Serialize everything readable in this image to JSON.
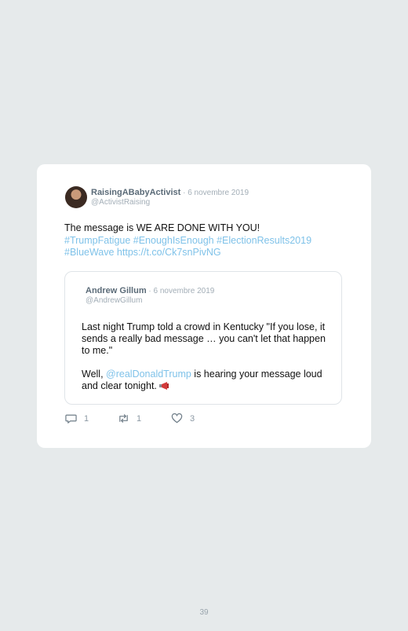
{
  "tweet": {
    "author_name": "RaisingABabyActivist",
    "date": " · 6 novembre 2019",
    "handle": "@ActivistRaising",
    "text_plain": "The message is WE ARE DONE WITH YOU!",
    "hashtags": "#TrumpFatigue #EnoughIsEnough #ElectionResults2019 #BlueWave https://t.co/Ck7snPivNG",
    "replies": "1",
    "retweets": "1",
    "likes": "3"
  },
  "quoted_tweet": {
    "author_name": "Andrew Gillum",
    "date": " · 6 novembre 2019",
    "handle": "@AndrewGillum",
    "paragraph1": "Last night Trump told a crowd in Kentucky \"If you lose, it sends a really bad message … you can't let that happen to me.\"",
    "paragraph2_before": "Well, ",
    "mention": "@realDonaldTrump",
    "paragraph2_after": " is hearing your message loud and clear tonight."
  },
  "page": {
    "number": "39"
  },
  "icons": {
    "reply": "reply-icon",
    "retweet": "retweet-icon",
    "like": "heart-icon",
    "megaphone": "megaphone-icon"
  },
  "colors": {
    "background": "#e6eaeb",
    "card": "#ffffff",
    "link": "#7fc2e9",
    "muted": "#a3aeb7"
  }
}
